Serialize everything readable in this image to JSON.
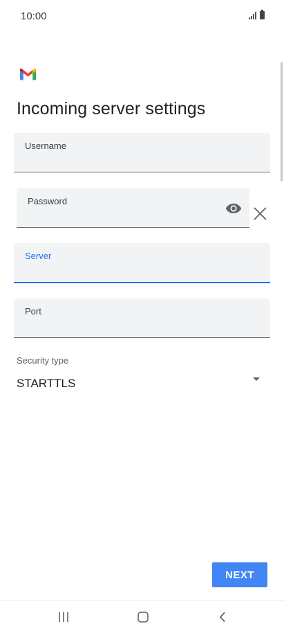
{
  "status_bar": {
    "time": "10:00",
    "icons": [
      "signal-icon",
      "battery-icon"
    ]
  },
  "app": {
    "logo": "gmail-logo",
    "title": "Incoming server settings"
  },
  "form": {
    "username": {
      "label": "Username",
      "value": ""
    },
    "password": {
      "label": "Password",
      "value": "",
      "icons": [
        "eye-icon",
        "clear-icon"
      ]
    },
    "server": {
      "label": "Server",
      "value": "",
      "focused": true
    },
    "port": {
      "label": "Port",
      "value": ""
    },
    "security_type": {
      "label": "Security type",
      "value": "STARTTLS"
    }
  },
  "actions": {
    "next_label": "NEXT"
  },
  "navigation": {
    "icons": [
      "recents-icon",
      "home-icon",
      "back-icon"
    ]
  },
  "colors": {
    "accent": "#1a73e8",
    "button": "#4285f4",
    "field_background": "#f1f3f4"
  }
}
